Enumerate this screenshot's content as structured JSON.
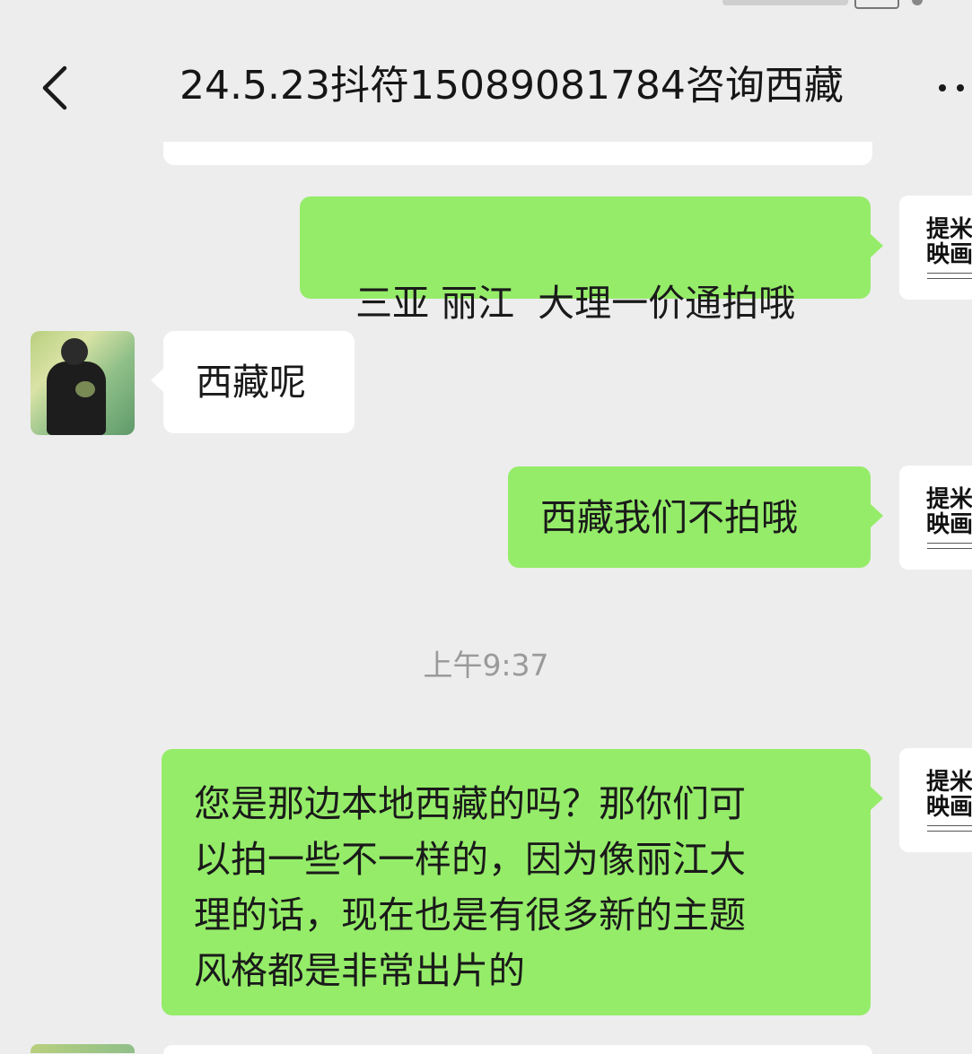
{
  "chat": {
    "title": "24.5.23抖符15089081784咨询西藏"
  },
  "business_avatar": {
    "line1": "提米",
    "line2": "映画"
  },
  "messages": [
    {
      "side": "right",
      "text": "三亚 丽江  大理一价通拍哦"
    },
    {
      "side": "left",
      "text": "西藏呢"
    },
    {
      "side": "right",
      "text": "西藏我们不拍哦"
    },
    {
      "side": "right",
      "lines": [
        "您是那边本地西藏的吗？那你们可",
        "以拍一些不一样的，因为像丽江大",
        "理的话，现在也是有很多新的主题",
        "风格都是非常出片的"
      ]
    }
  ],
  "timestamp": "上午9:37",
  "colors": {
    "background": "#ededed",
    "outgoing_bubble": "#95ec69",
    "incoming_bubble": "#ffffff"
  }
}
